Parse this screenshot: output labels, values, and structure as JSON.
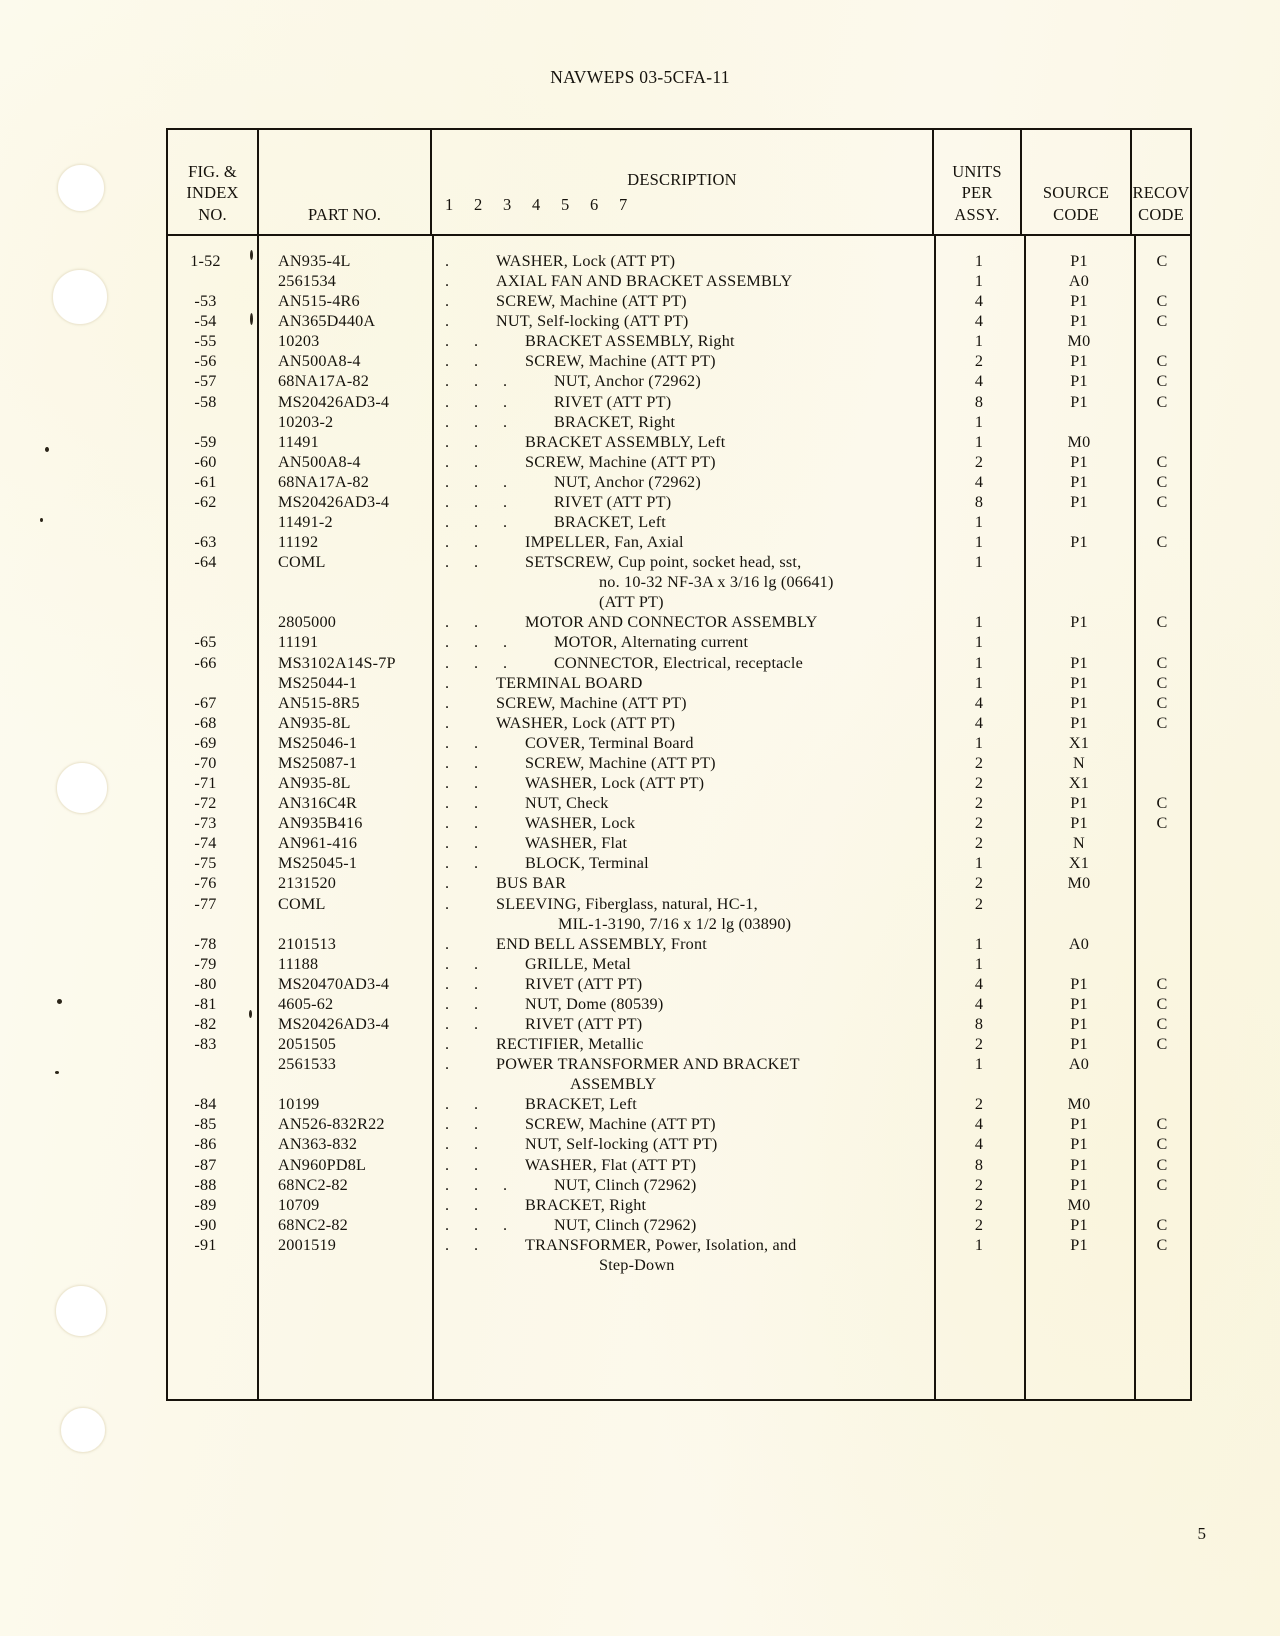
{
  "page": {
    "running_head": "NAVWEPS 03-5CFA-11",
    "folio": "5"
  },
  "table": {
    "headers": {
      "fig_index": [
        "FIG. &",
        "INDEX",
        "NO."
      ],
      "part_no": "PART NO.",
      "description": "DESCRIPTION",
      "description_levels": [
        "1",
        "2",
        "3",
        "4",
        "5",
        "6",
        "7"
      ],
      "units_per_assy": [
        "UNITS",
        "PER",
        "ASSY."
      ],
      "source_code": [
        "SOURCE",
        "CODE"
      ],
      "recov_code": [
        "RECOV",
        "CODE"
      ]
    },
    "rows": [
      {
        "index": "1-52",
        "part": "AN935-4L",
        "level": 1,
        "desc": "WASHER, Lock (ATT PT)",
        "units": "1",
        "source": "P1",
        "recov": "C"
      },
      {
        "index": "",
        "part": "2561534",
        "level": 1,
        "desc": "AXIAL FAN AND BRACKET ASSEMBLY",
        "units": "1",
        "source": "A0",
        "recov": ""
      },
      {
        "index": "-53",
        "part": "AN515-4R6",
        "level": 1,
        "desc": "SCREW, Machine (ATT PT)",
        "units": "4",
        "source": "P1",
        "recov": "C"
      },
      {
        "index": "-54",
        "part": "AN365D440A",
        "level": 1,
        "desc": "NUT, Self-locking (ATT PT)",
        "units": "4",
        "source": "P1",
        "recov": "C"
      },
      {
        "index": "-55",
        "part": "10203",
        "level": 2,
        "desc": "BRACKET ASSEMBLY, Right",
        "units": "1",
        "source": "M0",
        "recov": ""
      },
      {
        "index": "-56",
        "part": "AN500A8-4",
        "level": 2,
        "desc": "SCREW, Machine (ATT PT)",
        "units": "2",
        "source": "P1",
        "recov": "C"
      },
      {
        "index": "-57",
        "part": "68NA17A-82",
        "level": 3,
        "desc": "NUT, Anchor (72962)",
        "units": "4",
        "source": "P1",
        "recov": "C"
      },
      {
        "index": "-58",
        "part": "MS20426AD3-4",
        "level": 3,
        "desc": "RIVET (ATT PT)",
        "units": "8",
        "source": "P1",
        "recov": "C"
      },
      {
        "index": "",
        "part": "10203-2",
        "level": 3,
        "desc": "BRACKET, Right",
        "units": "1",
        "source": "",
        "recov": ""
      },
      {
        "index": "-59",
        "part": "11491",
        "level": 2,
        "desc": "BRACKET ASSEMBLY, Left",
        "units": "1",
        "source": "M0",
        "recov": ""
      },
      {
        "index": "-60",
        "part": "AN500A8-4",
        "level": 2,
        "desc": "SCREW, Machine (ATT PT)",
        "units": "2",
        "source": "P1",
        "recov": "C"
      },
      {
        "index": "-61",
        "part": "68NA17A-82",
        "level": 3,
        "desc": "NUT, Anchor (72962)",
        "units": "4",
        "source": "P1",
        "recov": "C"
      },
      {
        "index": "-62",
        "part": "MS20426AD3-4",
        "level": 3,
        "desc": "RIVET (ATT PT)",
        "units": "8",
        "source": "P1",
        "recov": "C"
      },
      {
        "index": "",
        "part": "11491-2",
        "level": 3,
        "desc": "BRACKET, Left",
        "units": "1",
        "source": "",
        "recov": ""
      },
      {
        "index": "-63",
        "part": "11192",
        "level": 2,
        "desc": "IMPELLER, Fan, Axial",
        "units": "1",
        "source": "P1",
        "recov": "C"
      },
      {
        "index": "-64",
        "part": "COML",
        "level": 2,
        "desc": "SETSCREW, Cup point, socket head, sst,",
        "units": "1",
        "source": "",
        "recov": "",
        "continuation": [
          "no. 10-32 NF-3A x 3/16 lg (06641)",
          "(ATT PT)"
        ],
        "continuation_offsets": [
          74,
          74
        ]
      },
      {
        "index": "",
        "part": "2805000",
        "level": 2,
        "desc": "MOTOR AND CONNECTOR ASSEMBLY",
        "units": "1",
        "source": "P1",
        "recov": "C"
      },
      {
        "index": "-65",
        "part": "11191",
        "level": 3,
        "desc": "MOTOR, Alternating current",
        "units": "1",
        "source": "",
        "recov": ""
      },
      {
        "index": "-66",
        "part": "MS3102A14S-7P",
        "level": 3,
        "desc": "CONNECTOR, Electrical, receptacle",
        "units": "1",
        "source": "P1",
        "recov": "C"
      },
      {
        "index": "",
        "part": "MS25044-1",
        "level": 1,
        "desc": "TERMINAL BOARD",
        "units": "1",
        "source": "P1",
        "recov": "C"
      },
      {
        "index": "-67",
        "part": "AN515-8R5",
        "level": 1,
        "desc": "SCREW, Machine (ATT PT)",
        "units": "4",
        "source": "P1",
        "recov": "C"
      },
      {
        "index": "-68",
        "part": "AN935-8L",
        "level": 1,
        "desc": "WASHER, Lock (ATT PT)",
        "units": "4",
        "source": "P1",
        "recov": "C"
      },
      {
        "index": "-69",
        "part": "MS25046-1",
        "level": 2,
        "desc": "COVER, Terminal Board",
        "units": "1",
        "source": "X1",
        "recov": ""
      },
      {
        "index": "-70",
        "part": "MS25087-1",
        "level": 2,
        "desc": "SCREW, Machine (ATT PT)",
        "units": "2",
        "source": "N",
        "recov": ""
      },
      {
        "index": "-71",
        "part": "AN935-8L",
        "level": 2,
        "desc": "WASHER, Lock (ATT PT)",
        "units": "2",
        "source": "X1",
        "recov": ""
      },
      {
        "index": "-72",
        "part": "AN316C4R",
        "level": 2,
        "desc": "NUT, Check",
        "units": "2",
        "source": "P1",
        "recov": "C"
      },
      {
        "index": "-73",
        "part": "AN935B416",
        "level": 2,
        "desc": "WASHER, Lock",
        "units": "2",
        "source": "P1",
        "recov": "C"
      },
      {
        "index": "-74",
        "part": "AN961-416",
        "level": 2,
        "desc": "WASHER, Flat",
        "units": "2",
        "source": "N",
        "recov": ""
      },
      {
        "index": "-75",
        "part": "MS25045-1",
        "level": 2,
        "desc": "BLOCK, Terminal",
        "units": "1",
        "source": "X1",
        "recov": ""
      },
      {
        "index": "-76",
        "part": "2131520",
        "level": 1,
        "desc": "BUS BAR",
        "units": "2",
        "source": "M0",
        "recov": ""
      },
      {
        "index": "-77",
        "part": "COML",
        "level": 1,
        "desc": "SLEEVING, Fiberglass, natural, HC-1,",
        "units": "2",
        "source": "",
        "recov": "",
        "continuation": [
          "MIL-1-3190, 7/16 x 1/2 lg (03890)"
        ],
        "continuation_offsets": [
          62
        ]
      },
      {
        "index": "-78",
        "part": "2101513",
        "level": 1,
        "desc": "END BELL ASSEMBLY, Front",
        "units": "1",
        "source": "A0",
        "recov": ""
      },
      {
        "index": "-79",
        "part": "11188",
        "level": 2,
        "desc": "GRILLE, Metal",
        "units": "1",
        "source": "",
        "recov": ""
      },
      {
        "index": "-80",
        "part": "MS20470AD3-4",
        "level": 2,
        "desc": "RIVET (ATT PT)",
        "units": "4",
        "source": "P1",
        "recov": "C"
      },
      {
        "index": "-81",
        "part": "4605-62",
        "level": 2,
        "desc": "NUT, Dome (80539)",
        "units": "4",
        "source": "P1",
        "recov": "C"
      },
      {
        "index": "-82",
        "part": "MS20426AD3-4",
        "level": 2,
        "desc": "RIVET (ATT PT)",
        "units": "8",
        "source": "P1",
        "recov": "C"
      },
      {
        "index": "-83",
        "part": "2051505",
        "level": 1,
        "desc": "RECTIFIER, Metallic",
        "units": "2",
        "source": "P1",
        "recov": "C"
      },
      {
        "index": "",
        "part": "2561533",
        "level": 1,
        "desc": "POWER TRANSFORMER AND BRACKET",
        "units": "1",
        "source": "A0",
        "recov": "",
        "continuation": [
          "ASSEMBLY"
        ],
        "continuation_offsets": [
          74
        ]
      },
      {
        "index": "-84",
        "part": "10199",
        "level": 2,
        "desc": "BRACKET, Left",
        "units": "2",
        "source": "M0",
        "recov": ""
      },
      {
        "index": "-85",
        "part": "AN526-832R22",
        "level": 2,
        "desc": "SCREW, Machine (ATT PT)",
        "units": "4",
        "source": "P1",
        "recov": "C"
      },
      {
        "index": "-86",
        "part": "AN363-832",
        "level": 2,
        "desc": "NUT, Self-locking (ATT PT)",
        "units": "4",
        "source": "P1",
        "recov": "C"
      },
      {
        "index": "-87",
        "part": "AN960PD8L",
        "level": 2,
        "desc": "WASHER, Flat (ATT PT)",
        "units": "8",
        "source": "P1",
        "recov": "C"
      },
      {
        "index": "-88",
        "part": "68NC2-82",
        "level": 3,
        "desc": "NUT, Clinch (72962)",
        "units": "2",
        "source": "P1",
        "recov": "C"
      },
      {
        "index": "-89",
        "part": "10709",
        "level": 2,
        "desc": "BRACKET, Right",
        "units": "2",
        "source": "M0",
        "recov": ""
      },
      {
        "index": "-90",
        "part": "68NC2-82",
        "level": 3,
        "desc": "NUT, Clinch (72962)",
        "units": "2",
        "source": "P1",
        "recov": "C"
      },
      {
        "index": "-91",
        "part": "2001519",
        "level": 2,
        "desc": "TRANSFORMER, Power, Isolation, and",
        "units": "1",
        "source": "P1",
        "recov": "C",
        "continuation": [
          "Step-Down"
        ],
        "continuation_offsets": [
          74
        ]
      }
    ]
  }
}
